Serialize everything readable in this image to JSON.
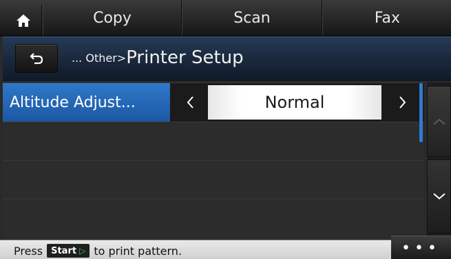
{
  "nav": {
    "home_icon": "home-icon",
    "tabs": [
      {
        "label": "Copy"
      },
      {
        "label": "Scan"
      },
      {
        "label": "Fax"
      }
    ]
  },
  "header": {
    "back_icon": "back-arrow-icon",
    "breadcrumb_prefix": "... Other>",
    "title": "Printer Setup"
  },
  "setting": {
    "label": "Altitude Adjust...",
    "value": "Normal",
    "prev_symbol": "<",
    "next_symbol": ">"
  },
  "scroll": {
    "up_icon": "chevron-up-icon",
    "down_icon": "chevron-down-icon"
  },
  "status": {
    "prefix": "Press",
    "start_label": "Start",
    "suffix": "to print pattern.",
    "more_label": "•••"
  },
  "colors": {
    "selected_row": "#2567b6",
    "scroll_thumb": "#2f7bd0",
    "start_icon": "#34c84a"
  }
}
